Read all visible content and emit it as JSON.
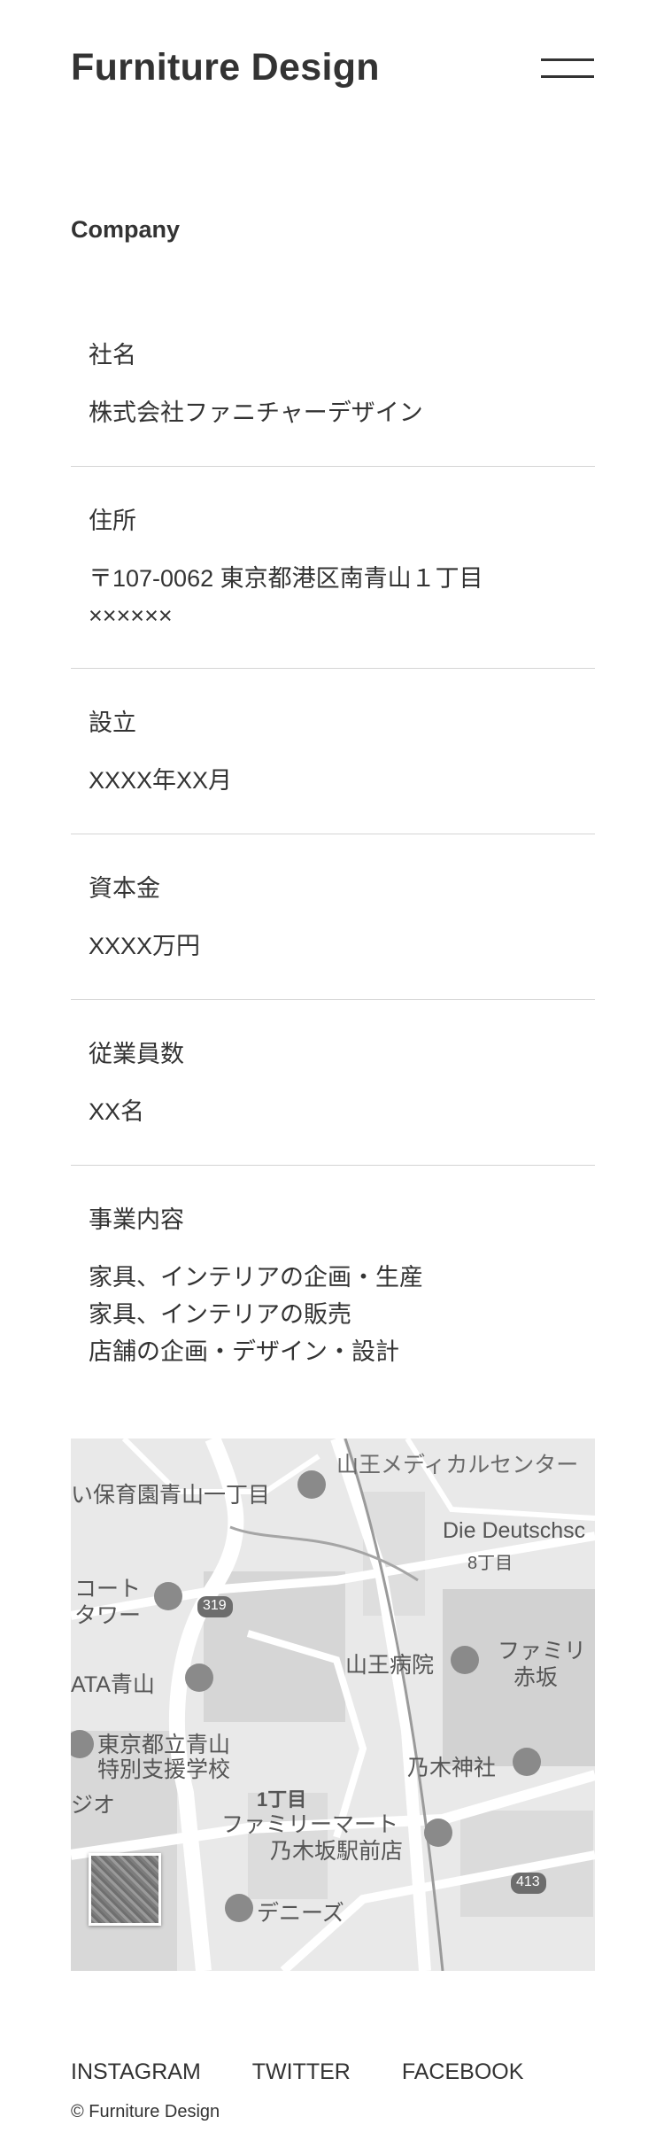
{
  "header": {
    "logo": "Furniture Design"
  },
  "section": {
    "title": "Company"
  },
  "company": {
    "rows": [
      {
        "label": "社名",
        "value": "株式会社ファニチャーデザイン"
      },
      {
        "label": "住所",
        "value": "〒107-0062 東京都港区南青山１丁目\n××××××"
      },
      {
        "label": "設立",
        "value": "XXXX年XX月"
      },
      {
        "label": "資本金",
        "value": "XXXX万円"
      },
      {
        "label": "従業員数",
        "value": "XX名"
      },
      {
        "label": "事業内容",
        "value": "家具、インテリアの企画・生産\n家具、インテリアの販売\n店舗の企画・デザイン・設計"
      }
    ]
  },
  "map": {
    "labels": {
      "sanno_medical": "山王メディカルセンター",
      "hoikuen": "い保育園青山一丁目",
      "deutsch": "Die Deutschsc",
      "chome8": "8丁目",
      "court": "コート",
      "tower": "タワー",
      "route319": "319",
      "sanno_hospital": "山王病院",
      "family": "ファミリ",
      "akasaka": "赤坂",
      "ata": "ATA青山",
      "school1": "東京都立青山",
      "school2": "特別支援学校",
      "jio": "ジオ",
      "nogi": "乃木神社",
      "chome1": "1丁目",
      "familymart1": "ファミリーマート",
      "familymart2": "乃木坂駅前店",
      "route413": "413",
      "dennys": "デニーズ"
    },
    "colors": {
      "base": "#e9e9e9",
      "road": "#ffffff",
      "block": "#d8d8d8",
      "park": "#cfcfcf"
    }
  },
  "footer": {
    "links": [
      "INSTAGRAM",
      "TWITTER",
      "FACEBOOK"
    ],
    "copyright": "© Furniture Design"
  }
}
